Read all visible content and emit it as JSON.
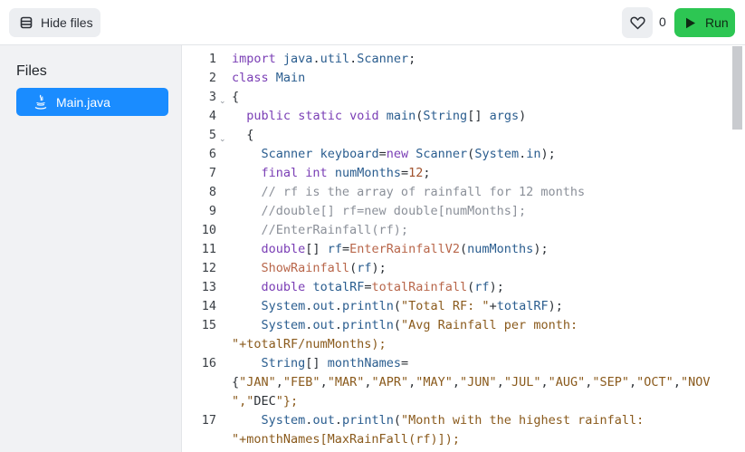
{
  "toolbar": {
    "hide_files_label": "Hide files",
    "like_count": "0",
    "run_label": "Run"
  },
  "sidebar": {
    "title": "Files",
    "files": [
      {
        "name": "Main.java"
      }
    ]
  },
  "editor": {
    "line_numbers": [
      "1",
      "2",
      "3",
      "4",
      "5",
      "6",
      "7",
      "8",
      "9",
      "10",
      "11",
      "12",
      "13",
      "14",
      "15",
      "16",
      "17"
    ],
    "code_lines": [
      "import java.util.Scanner;",
      "class Main",
      "{",
      "  public static void main(String[] args)",
      "  {",
      "    Scanner keyboard=new Scanner(System.in);",
      "    final int numMonths=12;",
      "    // rf is the array of rainfall for 12 months",
      "    //double[] rf=new double[numMonths];",
      "    //EnterRainfall(rf);",
      "    double[] rf=EnterRainfallV2(numMonths);",
      "    ShowRainfall(rf);",
      "    double totalRF=totalRainfall(rf);",
      "    System.out.println(\"Total RF: \"+totalRF);",
      "    System.out.println(\"Avg Rainfall per month:",
      "\"+totalRF/numMonths);",
      "    String[] monthNames=",
      "{\"JAN\",\"FEB\",\"MAR\",\"APR\",\"MAY\",\"JUN\",\"JUL\",\"AUG\",\"SEP\",\"OCT\",\"NOV",
      "\",\"DEC\"};",
      "    System.out.println(\"Month with the highest rainfall:",
      "\"+monthNames[MaxRainFall(rf)]);"
    ]
  }
}
